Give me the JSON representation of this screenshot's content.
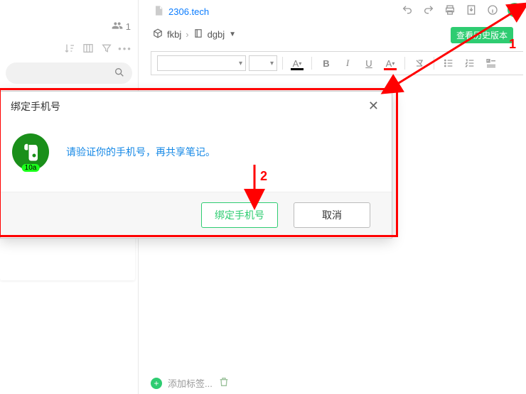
{
  "header": {
    "doc_title": "2306.tech",
    "history_button": "查看历史版本"
  },
  "breadcrumb": {
    "item1": "fkbj",
    "item2": "dgbj"
  },
  "left": {
    "share_count": "1"
  },
  "toolbar": {
    "font_letter": "A",
    "highlight_letter": "A",
    "bold": "B",
    "italic": "I",
    "underline": "U",
    "strike": "S"
  },
  "dialog": {
    "title": "绑定手机号",
    "message": "请验证你的手机号，再共享笔记。",
    "primary_btn": "绑定手机号",
    "cancel_btn": "取消",
    "logo_badge": "10a"
  },
  "tags": {
    "add_label": "添加标签..."
  },
  "annotations": {
    "n1": "1",
    "n2": "2"
  }
}
